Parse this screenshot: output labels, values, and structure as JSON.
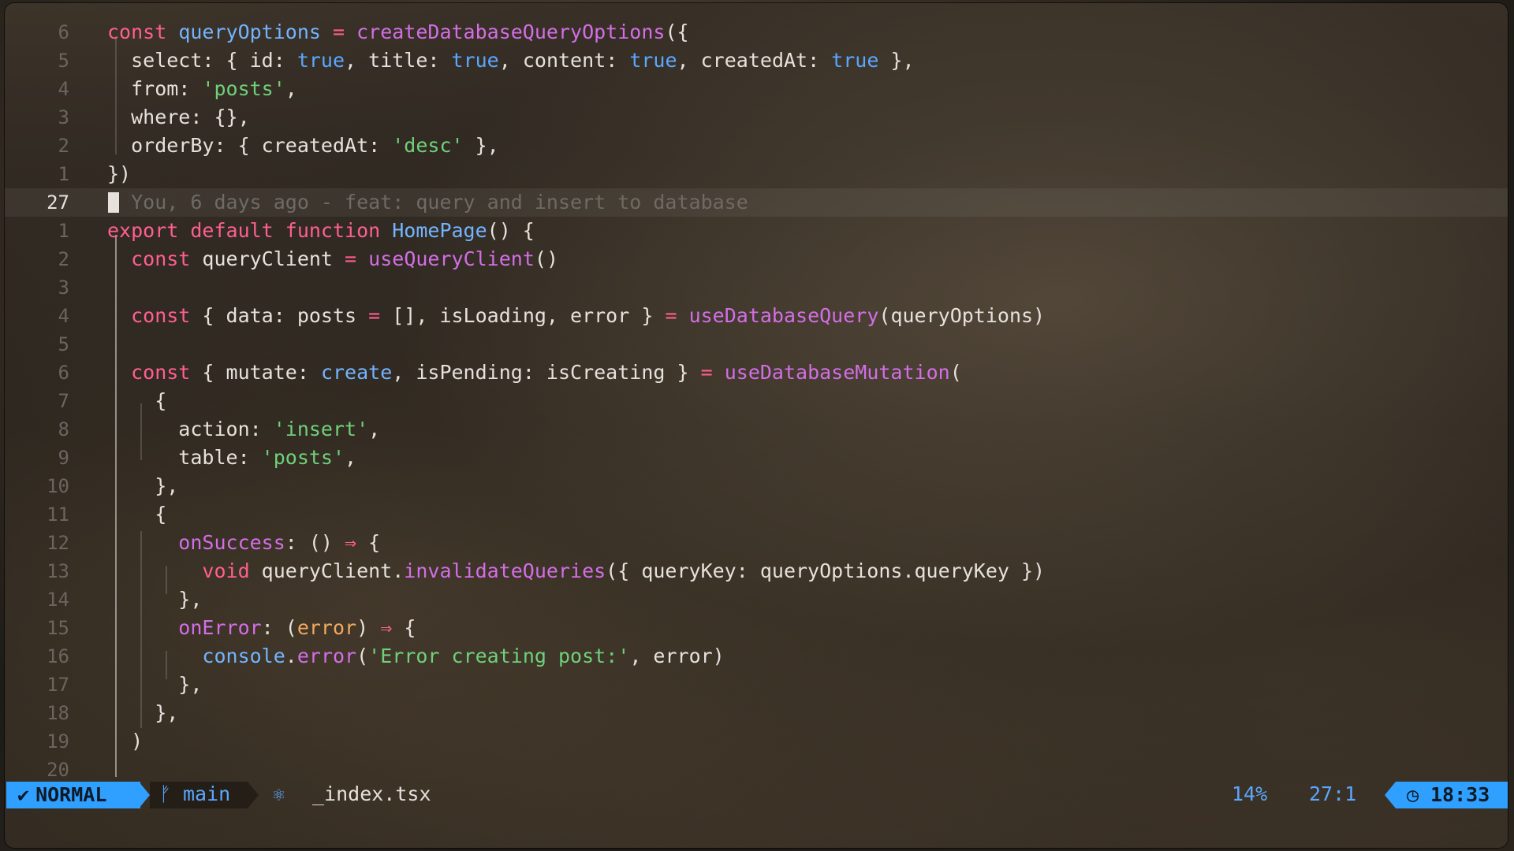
{
  "editor": {
    "lines": [
      {
        "num": "6",
        "tokens": [
          [
            "kw",
            "const "
          ],
          [
            "id",
            "queryOptions"
          ],
          [
            "op",
            " = "
          ],
          [
            "fn",
            "createDatabaseQueryOptions"
          ],
          [
            "",
            "({"
          ]
        ]
      },
      {
        "num": "5",
        "tokens": [
          [
            "",
            "  select: { id: "
          ],
          [
            "bool",
            "true"
          ],
          [
            "",
            ", title: "
          ],
          [
            "bool",
            "true"
          ],
          [
            "",
            ", content: "
          ],
          [
            "bool",
            "true"
          ],
          [
            "",
            ", createdAt: "
          ],
          [
            "bool",
            "true"
          ],
          [
            "",
            " },"
          ]
        ]
      },
      {
        "num": "4",
        "tokens": [
          [
            "",
            "  from: "
          ],
          [
            "str",
            "'posts'"
          ],
          [
            "",
            ","
          ]
        ]
      },
      {
        "num": "3",
        "tokens": [
          [
            "",
            "  where: {},"
          ]
        ]
      },
      {
        "num": "2",
        "tokens": [
          [
            "",
            "  orderBy: { createdAt: "
          ],
          [
            "str",
            "'desc'"
          ],
          [
            "",
            " },"
          ]
        ]
      },
      {
        "num": "1",
        "tokens": [
          [
            "",
            "})"
          ]
        ]
      },
      {
        "num": "27",
        "current": true,
        "tokens": [
          [
            "",
            "  "
          ],
          [
            "comment",
            "You, 6 days ago - feat: query and insert to database"
          ]
        ]
      },
      {
        "num": "1",
        "tokens": [
          [
            "kw",
            "export default function "
          ],
          [
            "id",
            "HomePage"
          ],
          [
            "",
            "() {"
          ]
        ]
      },
      {
        "num": "2",
        "tokens": [
          [
            "kw",
            "  const "
          ],
          [
            "",
            "queryClient "
          ],
          [
            "op",
            "="
          ],
          [
            "",
            " "
          ],
          [
            "fn",
            "useQueryClient"
          ],
          [
            "",
            "()"
          ]
        ]
      },
      {
        "num": "3",
        "tokens": [
          [
            "",
            ""
          ]
        ]
      },
      {
        "num": "4",
        "tokens": [
          [
            "kw",
            "  const "
          ],
          [
            "",
            "{ data: posts "
          ],
          [
            "op",
            "="
          ],
          [
            "",
            " [], isLoading, error } "
          ],
          [
            "op",
            "="
          ],
          [
            "",
            " "
          ],
          [
            "fn",
            "useDatabaseQuery"
          ],
          [
            "",
            "(queryOptions)"
          ]
        ]
      },
      {
        "num": "5",
        "tokens": [
          [
            "",
            ""
          ]
        ]
      },
      {
        "num": "6",
        "tokens": [
          [
            "kw",
            "  const "
          ],
          [
            "",
            "{ mutate: "
          ],
          [
            "id",
            "create"
          ],
          [
            "",
            ", isPending: isCreating } "
          ],
          [
            "op",
            "="
          ],
          [
            "",
            " "
          ],
          [
            "fn",
            "useDatabaseMutation"
          ],
          [
            "",
            "("
          ]
        ]
      },
      {
        "num": "7",
        "tokens": [
          [
            "",
            "    {"
          ]
        ]
      },
      {
        "num": "8",
        "tokens": [
          [
            "",
            "      action: "
          ],
          [
            "str",
            "'insert'"
          ],
          [
            "",
            ","
          ]
        ]
      },
      {
        "num": "9",
        "tokens": [
          [
            "",
            "      table: "
          ],
          [
            "str",
            "'posts'"
          ],
          [
            "",
            ","
          ]
        ]
      },
      {
        "num": "10",
        "tokens": [
          [
            "",
            "    },"
          ]
        ]
      },
      {
        "num": "11",
        "tokens": [
          [
            "",
            "    {"
          ]
        ]
      },
      {
        "num": "12",
        "tokens": [
          [
            "prop",
            "      onSuccess"
          ],
          [
            "",
            ": () "
          ],
          [
            "op",
            "⇒"
          ],
          [
            "",
            " {"
          ]
        ]
      },
      {
        "num": "13",
        "tokens": [
          [
            "kw",
            "        void "
          ],
          [
            "",
            "queryClient."
          ],
          [
            "fn",
            "invalidateQueries"
          ],
          [
            "",
            "({ queryKey: queryOptions.queryKey })"
          ]
        ]
      },
      {
        "num": "14",
        "tokens": [
          [
            "",
            "      },"
          ]
        ]
      },
      {
        "num": "15",
        "tokens": [
          [
            "prop",
            "      onError"
          ],
          [
            "",
            ": ("
          ],
          [
            "param",
            "error"
          ],
          [
            "",
            ") "
          ],
          [
            "op",
            "⇒"
          ],
          [
            "",
            " {"
          ]
        ]
      },
      {
        "num": "16",
        "tokens": [
          [
            "id",
            "        console"
          ],
          [
            "",
            "."
          ],
          [
            "fn",
            "error"
          ],
          [
            "",
            "("
          ],
          [
            "str",
            "'Error creating post:'"
          ],
          [
            "",
            ", error)"
          ]
        ]
      },
      {
        "num": "17",
        "tokens": [
          [
            "",
            "      },"
          ]
        ]
      },
      {
        "num": "18",
        "tokens": [
          [
            "",
            "    },"
          ]
        ]
      },
      {
        "num": "19",
        "tokens": [
          [
            "",
            "  )"
          ]
        ]
      },
      {
        "num": "20",
        "tokens": [
          [
            "",
            ""
          ]
        ]
      }
    ]
  },
  "statusbar": {
    "mode": "NORMAL",
    "mode_icon": "vim-icon",
    "branch_icon": "git-branch-icon",
    "branch": "main",
    "file_icon": "react-icon",
    "file": "_index.tsx",
    "percent": "14%",
    "position": "27:1",
    "clock_icon": "clock-icon",
    "time": "18:33"
  },
  "colors": {
    "accent": "#2fa0ff",
    "keyword": "#ff5f8f",
    "function": "#d36ee6",
    "identifier": "#73b4ff",
    "string": "#6fd17a",
    "comment": "#6e6a64"
  }
}
